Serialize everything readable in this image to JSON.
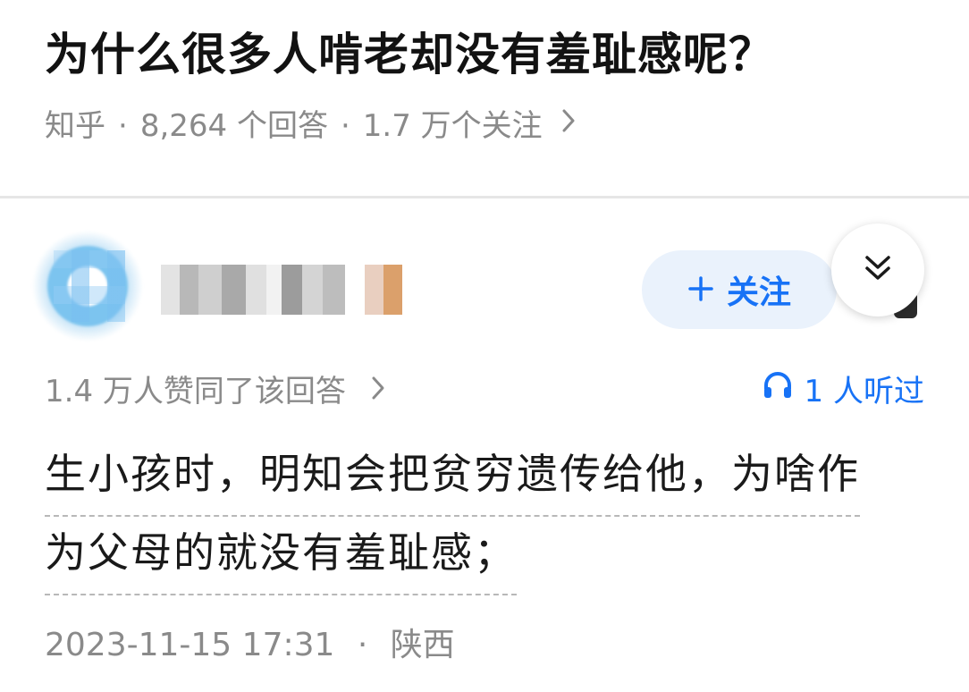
{
  "question": {
    "title": "为什么很多人啃老却没有羞耻感呢？",
    "source": "知乎",
    "answer_count": "8,264 个回答",
    "follower_count": "1.7 万个关注",
    "separator": "·",
    "more_icon": "chevron-right-icon"
  },
  "author": {
    "avatar_icon": "avatar",
    "follow_label": "关注",
    "follow_icon": "plus-icon",
    "collapse_icon": "double-chevron-down-icon"
  },
  "answer": {
    "vote_text": "1.4 万人赞同了该回答",
    "listen_text": "1 人听过",
    "listen_icon": "headphones-icon",
    "content_lines": [
      "生小孩时，明知会把贫穷遗传给他，为啥作",
      "为父母的就没有羞耻感；"
    ],
    "date": "2023-11-15 17:31",
    "location": "陕西",
    "separator": "·"
  },
  "colors": {
    "accent": "#1772f6",
    "follow_bg": "#eaf2fc",
    "meta_gray": "#8a8a8a",
    "title": "#121212"
  }
}
